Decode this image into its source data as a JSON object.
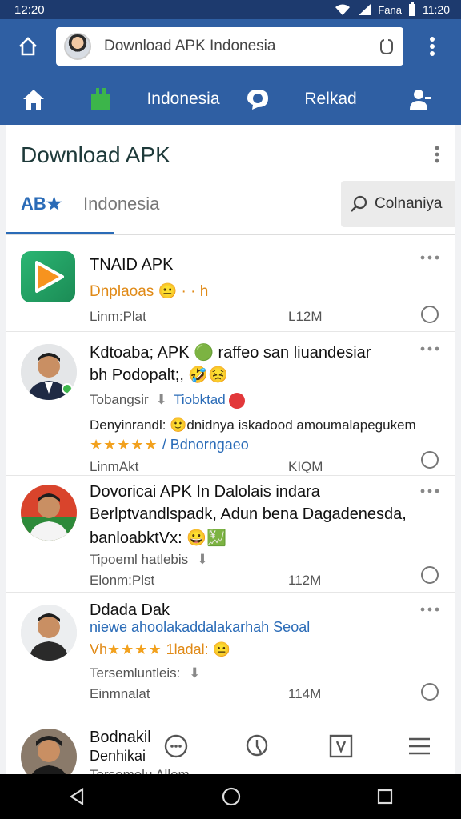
{
  "status": {
    "time_left": "12:20",
    "time_right": "11:20",
    "carrier": "Fana"
  },
  "browser": {
    "url": "Download APK Indonesia"
  },
  "nav": {
    "location": "Indonesia",
    "related": "Relkad"
  },
  "page": {
    "title": "Download APK",
    "tab_active": "AB★",
    "tab_inactive": "Indonesia",
    "search_label": "Colnaniya"
  },
  "items": [
    {
      "title": "TNAID APK",
      "sub": "Dnplaoas 😐 · · h",
      "meta": "Linm:Plat",
      "size": "L12M"
    },
    {
      "title": "Kdtoaba; APK 🟢 raffeo san liuandesiar",
      "title2": "bh Podopalt;,  🤣😣",
      "tag_left": "Tobangsir",
      "tag_right": "Tiobktad",
      "desc": "Denyinrandl: 🙂dnidnya iskadood amoumalapegukem",
      "rating": "★★★★★",
      "rating_text": "/ Bdnorngaeo",
      "meta": "LinmAkt",
      "size": "KIQM"
    },
    {
      "title": "Dovoricai APK In Dalolais indara",
      "title2": "Berlptvandlspadk, Adun bena Dagadenesda,",
      "title3": "banloabktVx: 😀💹",
      "tag_left": "Tipoeml hatlebis",
      "meta": "Elonm:Plst",
      "size": "112M"
    },
    {
      "title": "Ddada Dak",
      "sub": "niewe ahoolakaddalakarhah Seoal",
      "rating": "★★★★",
      "rating_prefix": "Vh",
      "rating_text": "1ladal: 😐",
      "tag_left": "Tersemluntleis:",
      "meta": "Einmnalat",
      "size": "114M"
    },
    {
      "title": "Bodnakil",
      "title2": "Denhikai",
      "tag_left": "Tersemelu Allem"
    }
  ],
  "colors": {
    "header": "#2f5fa3",
    "status": "#1d3a6e",
    "accent": "#2a6bb7",
    "star": "#f2a11e"
  }
}
